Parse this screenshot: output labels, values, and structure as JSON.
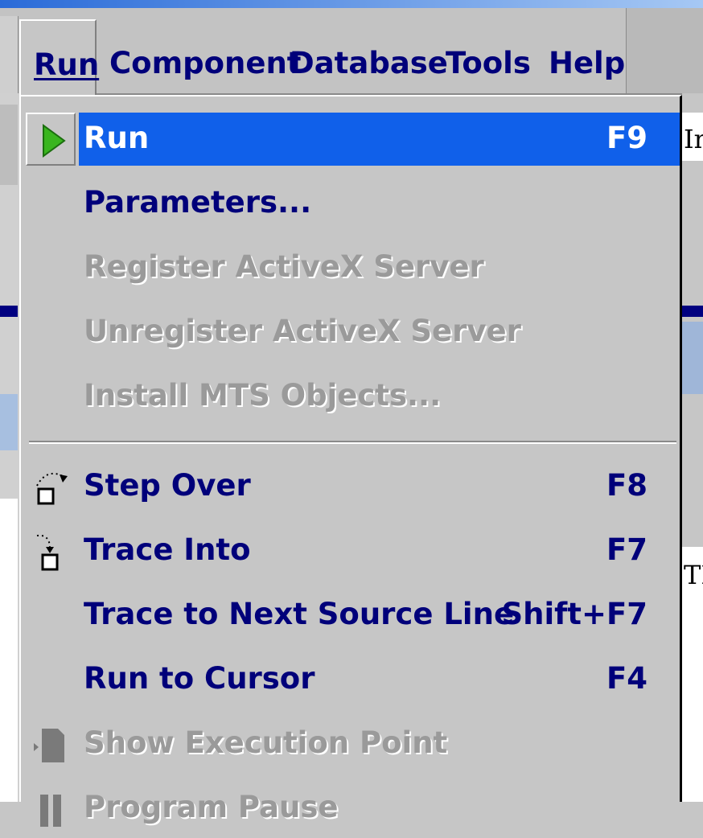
{
  "menubar": {
    "items": [
      {
        "label": "Run"
      },
      {
        "label": "Component"
      },
      {
        "label": "Database"
      },
      {
        "label": "Tools"
      },
      {
        "label": "Help"
      }
    ]
  },
  "background": {
    "right_text_top": "In",
    "right_text_mid": "TI"
  },
  "run_menu": {
    "items": [
      {
        "label": "Run",
        "shortcut": "F9",
        "icon": "run-arrow-icon",
        "state": "highlighted"
      },
      {
        "label": "Parameters...",
        "shortcut": "",
        "state": "enabled"
      },
      {
        "label": "Register ActiveX Server",
        "shortcut": "",
        "state": "disabled"
      },
      {
        "label": "Unregister ActiveX Server",
        "shortcut": "",
        "state": "disabled"
      },
      {
        "label": "Install MTS Objects...",
        "shortcut": "",
        "state": "disabled"
      },
      {
        "label": "Step Over",
        "shortcut": "F8",
        "icon": "step-over-icon",
        "state": "enabled"
      },
      {
        "label": "Trace Into",
        "shortcut": "F7",
        "icon": "trace-into-icon",
        "state": "enabled"
      },
      {
        "label": "Trace to Next Source Line",
        "shortcut": "Shift+F7",
        "state": "enabled"
      },
      {
        "label": "Run to Cursor",
        "shortcut": "F4",
        "state": "enabled"
      },
      {
        "label": "Show Execution Point",
        "shortcut": "",
        "icon": "execution-point-icon",
        "state": "disabled"
      },
      {
        "label": "Program Pause",
        "shortcut": "",
        "icon": "pause-icon",
        "state": "disabled"
      }
    ]
  },
  "colors": {
    "menu_text": "#00007a",
    "highlight": "#1060ea",
    "disabled_text": "#9a9a9a",
    "run_icon": "#39b51e"
  }
}
